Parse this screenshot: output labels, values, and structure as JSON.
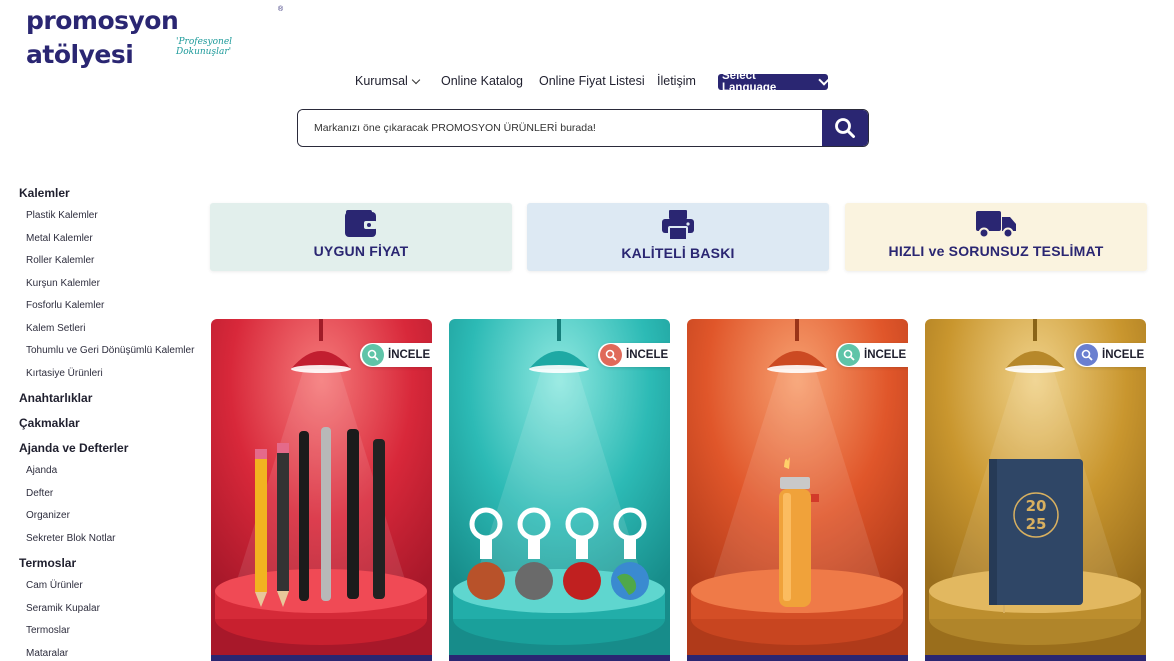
{
  "logo": {
    "name": "promosyon atölyesi",
    "tagline": "'Profesyonel Dokunuşlar'",
    "registered": "®"
  },
  "nav": {
    "items": [
      "Kurumsal",
      "Online Katalog",
      "Online Fiyat Listesi",
      "İletişim"
    ],
    "language_button": "Select Language"
  },
  "search": {
    "placeholder": "Markanızı öne çıkaracak PROMOSYON ÜRÜNLERİ burada!"
  },
  "sidebar": {
    "groups": [
      {
        "title": "Kalemler",
        "items": [
          "Plastik Kalemler",
          "Metal Kalemler",
          "Roller Kalemler",
          "Kurşun Kalemler",
          "Fosforlu Kalemler",
          "Kalem Setleri",
          "Tohumlu ve Geri Dönüşümlü Kalemler",
          "Kırtasiye Ürünleri"
        ]
      },
      {
        "title": "Anahtarlıklar",
        "items": []
      },
      {
        "title": "Çakmaklar",
        "items": []
      },
      {
        "title": "Ajanda ve Defterler",
        "items": [
          "Ajanda",
          "Defter",
          "Organizer",
          "Sekreter Blok Notlar"
        ]
      },
      {
        "title": "Termoslar",
        "items": [
          "Cam Ürünler",
          "Seramik Kupalar",
          "Termoslar",
          "Mataralar"
        ]
      }
    ]
  },
  "features": [
    {
      "label": "UYGUN FİYAT",
      "icon": "wallet-icon"
    },
    {
      "label": "KALİTELİ BASKI",
      "icon": "printer-icon"
    },
    {
      "label": "HIZLI ve SORUNSUZ TESLİMAT",
      "icon": "truck-icon"
    }
  ],
  "cards": [
    {
      "button": "İNCELE",
      "theme": "red",
      "bg": "#d8283a",
      "icon_color": "#5fc4a8",
      "product": "pens"
    },
    {
      "button": "İNCELE",
      "theme": "teal",
      "bg": "#2cbab5",
      "icon_color": "#e06a5a",
      "product": "keychains"
    },
    {
      "button": "İNCELE",
      "theme": "orange",
      "bg": "#e0562a",
      "icon_color": "#5fc4a8",
      "product": "lighter"
    },
    {
      "button": "İNCELE",
      "theme": "gold",
      "bg": "#c9962e",
      "icon_color": "#6a7fd0",
      "product": "notebook"
    }
  ],
  "notebook_print": "2025",
  "colors": {
    "brand": "#2a2672",
    "accent_teal": "#1c9a9a"
  }
}
